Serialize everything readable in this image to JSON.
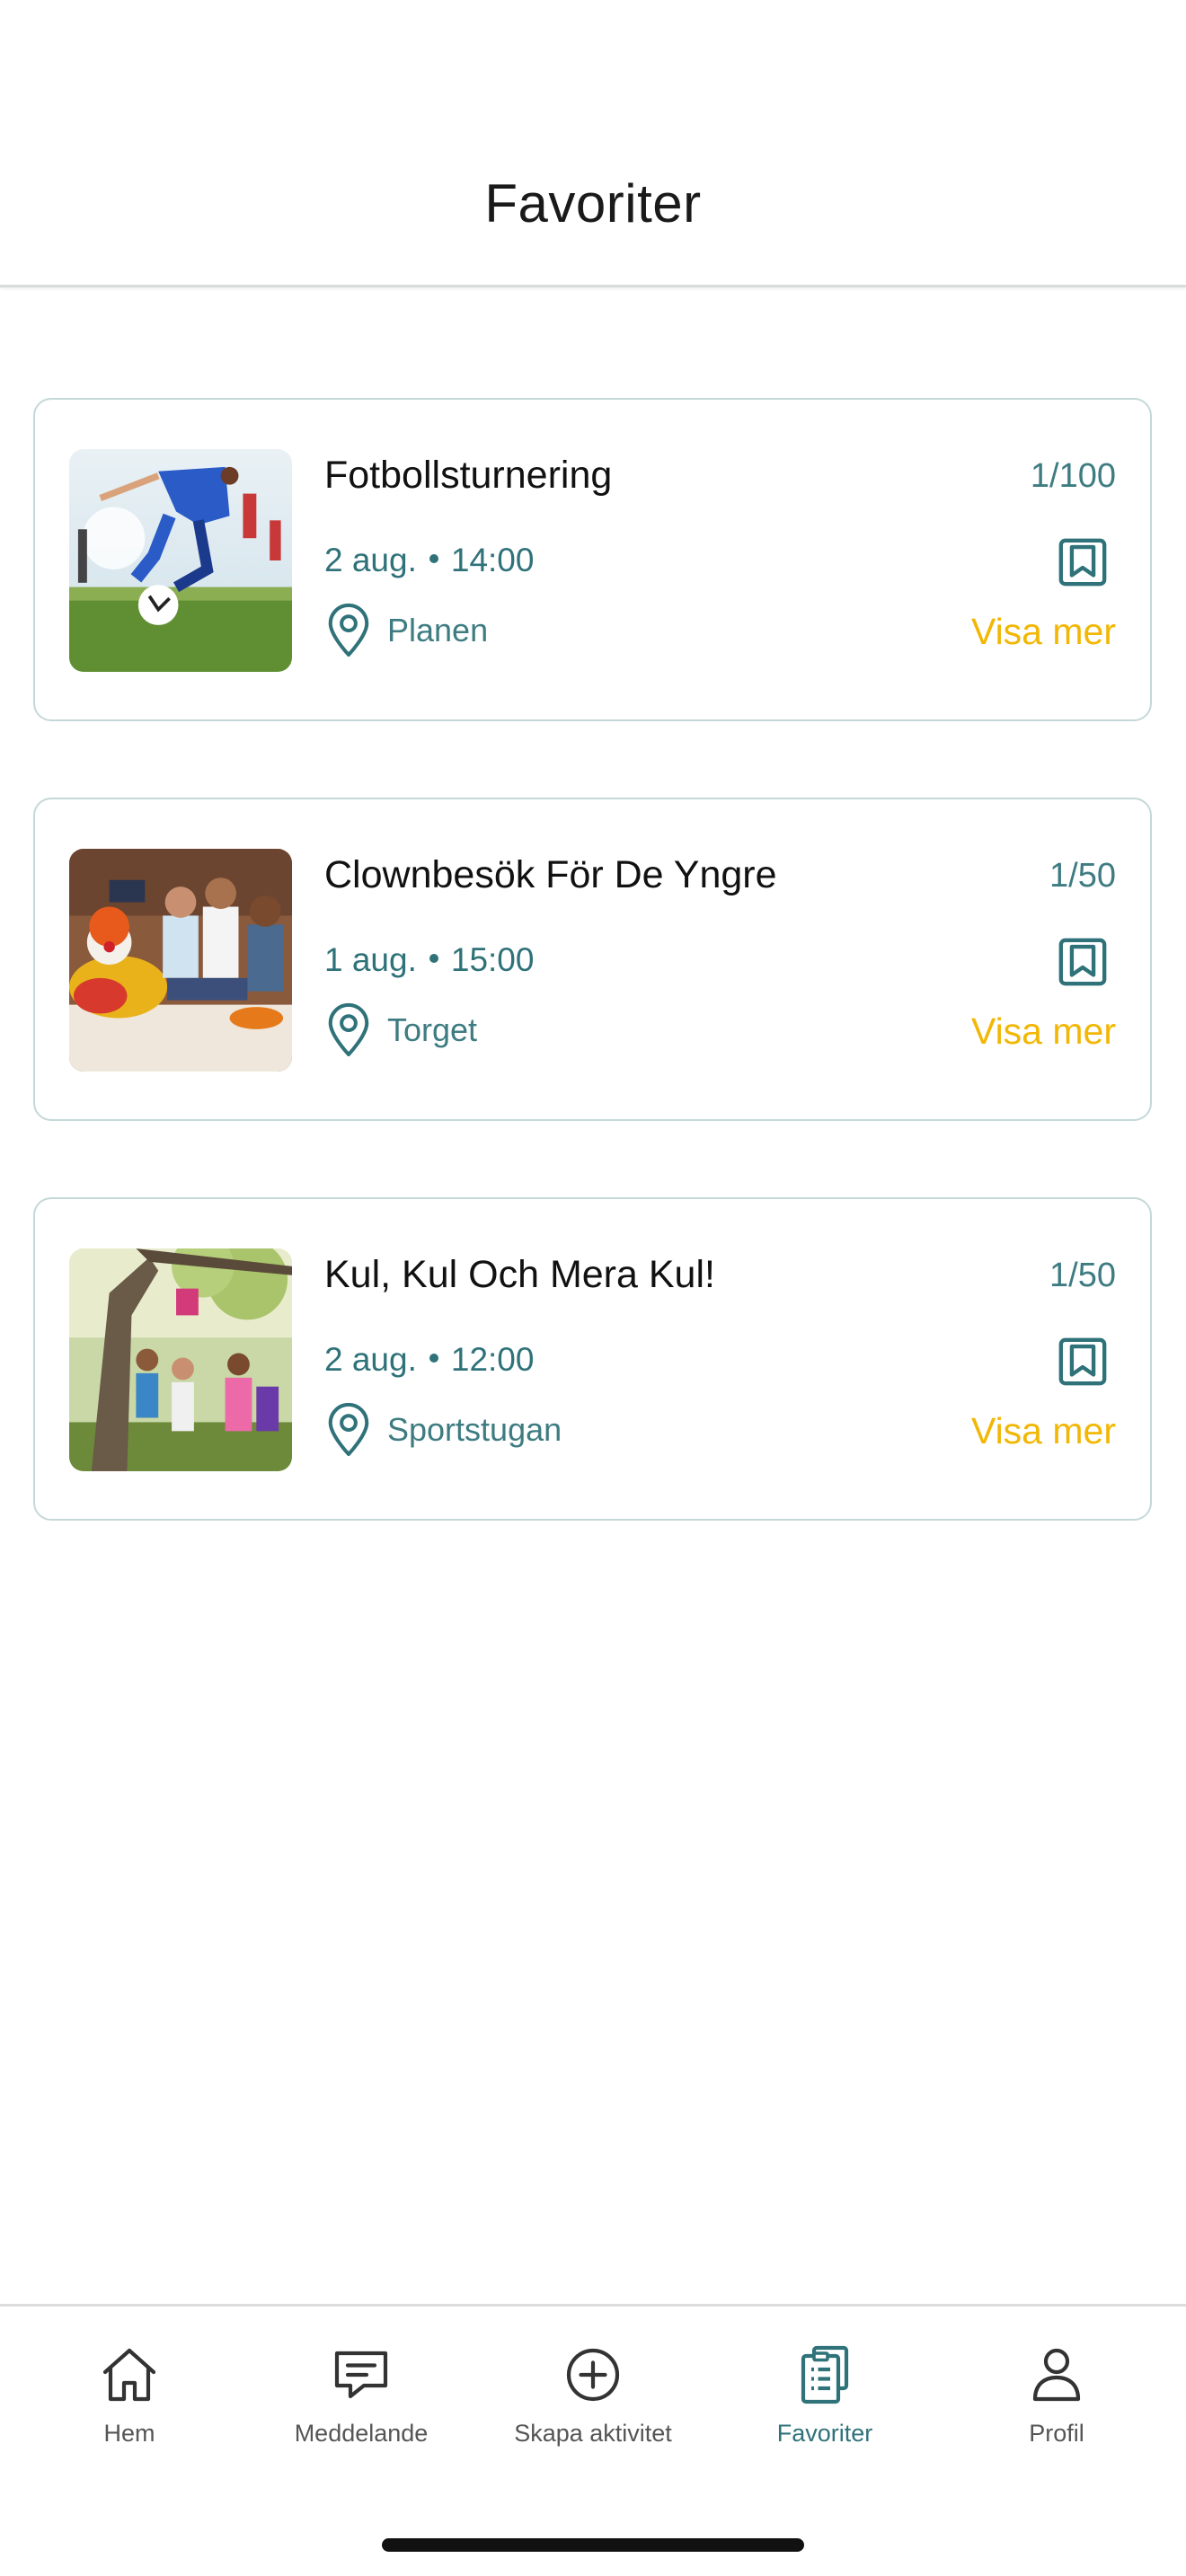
{
  "header": {
    "title": "Favoriter"
  },
  "cards": [
    {
      "title": "Fotbollsturnering",
      "count": "1/100",
      "date": "2 aug.",
      "time": "14:00",
      "location": "Planen",
      "more_label": "Visa mer"
    },
    {
      "title": "Clownbesök För De Yngre",
      "count": "1/50",
      "date": "1 aug.",
      "time": "15:00",
      "location": "Torget",
      "more_label": "Visa mer"
    },
    {
      "title": "Kul, Kul Och Mera Kul!",
      "count": "1/50",
      "date": "2 aug.",
      "time": "12:00",
      "location": "Sportstugan",
      "more_label": "Visa mer"
    }
  ],
  "nav": {
    "items": [
      {
        "label": "Hem",
        "icon": "home-icon"
      },
      {
        "label": "Meddelande",
        "icon": "message-icon"
      },
      {
        "label": "Skapa aktivitet",
        "icon": "plus-circle-icon"
      },
      {
        "label": "Favoriter",
        "icon": "clipboard-list-icon",
        "active": true
      },
      {
        "label": "Profil",
        "icon": "user-icon"
      }
    ]
  },
  "colors": {
    "accent": "#2f7279",
    "highlight": "#f2b705",
    "card_border": "#c5d8d8"
  }
}
